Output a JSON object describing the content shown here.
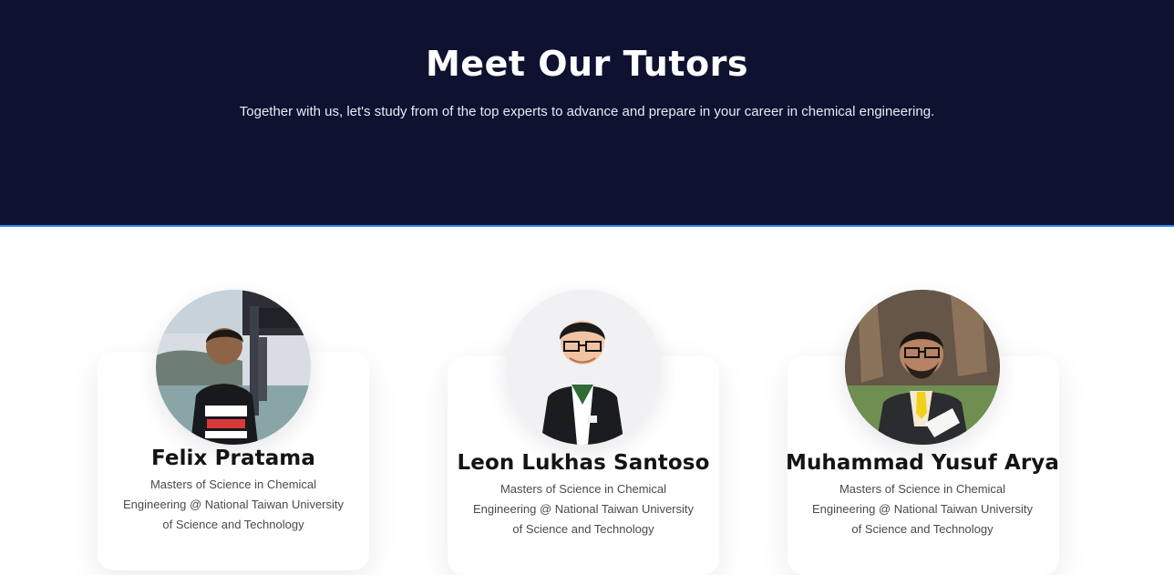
{
  "header": {
    "title": "Meet Our Tutors",
    "subtitle": "Together with us, let's study from of the top experts to advance and prepare in your career in chemical engineering.",
    "background_color": "#0e1130",
    "accent_color": "#2d8cff"
  },
  "tutors": [
    {
      "name": "Felix Pratama",
      "description": "Masters of Science in Chemical\nEngineering @ National Taiwan University\nof Science and Technology",
      "photo_icon": "tutor-photo-felix"
    },
    {
      "name": "Leon Lukhas Santoso",
      "description": "Masters of Science in Chemical\nEngineering @ National Taiwan University\nof Science and Technology",
      "photo_icon": "tutor-photo-leon"
    },
    {
      "name": "Muhammad Yusuf Arya",
      "description": "Masters of Science in Chemical\nEngineering @ National Taiwan University\nof Science and Technology",
      "photo_icon": "tutor-photo-yusuf"
    }
  ]
}
